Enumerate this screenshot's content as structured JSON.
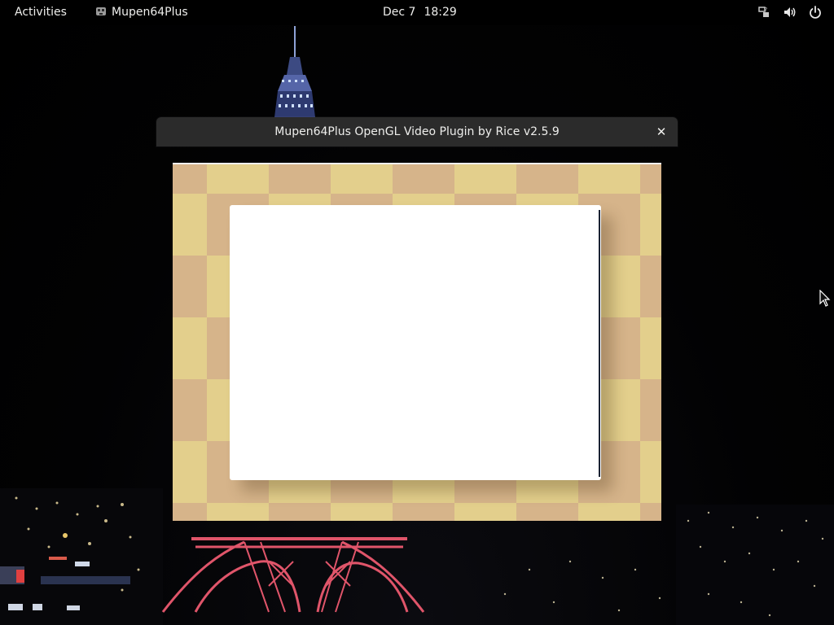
{
  "topbar": {
    "activities_label": "Activities",
    "app_name": "Mupen64Plus",
    "clock_date": "Dec 7",
    "clock_time": "18:29",
    "tray_icons": [
      "network-icon",
      "volume-icon",
      "power-icon"
    ]
  },
  "window": {
    "title": "Mupen64Plus OpenGL Video Plugin by Rice v2.5.9",
    "close_glyph": "✕"
  },
  "colors": {
    "topbar_bg": "#000000",
    "titlebar_bg": "#2b2b2b",
    "checker_light": "#e3cf8c",
    "checker_dark": "#d6b48a",
    "panel_bg": "#ffffff"
  }
}
